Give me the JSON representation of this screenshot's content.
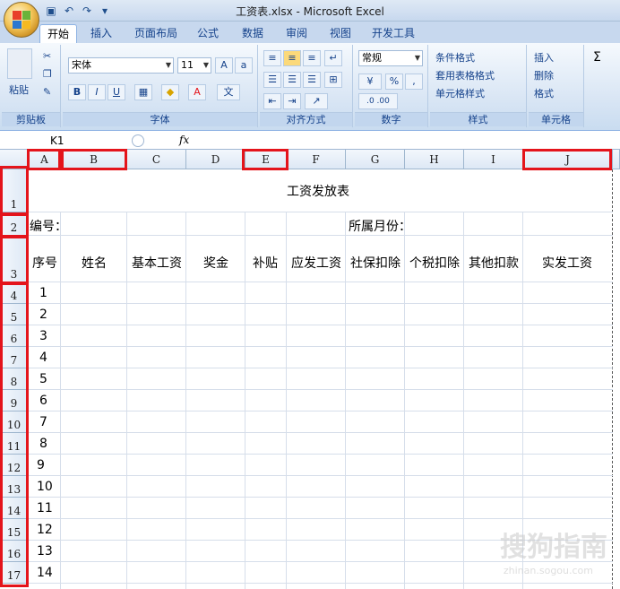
{
  "window": {
    "title": "工资表.xlsx - Microsoft Excel"
  },
  "qat": [
    "save-icon",
    "undo-icon",
    "redo-icon",
    "customize-icon"
  ],
  "tabs": [
    "开始",
    "插入",
    "页面布局",
    "公式",
    "数据",
    "审阅",
    "视图",
    "开发工具"
  ],
  "ribbon": {
    "clipboard": {
      "paste": "粘贴",
      "label": "剪贴板"
    },
    "font": {
      "name": "宋体",
      "size": "11",
      "bold": "B",
      "italic": "I",
      "underline": "U",
      "label": "字体"
    },
    "alignment": {
      "label": "对齐方式"
    },
    "number": {
      "format": "常规",
      "percent": "%",
      "comma": ",",
      "inc": ".0 .00",
      "label": "数字"
    },
    "styles": {
      "conditional": "条件格式",
      "table": "套用表格格式",
      "cell": "单元格样式",
      "label": "样式"
    },
    "cells": {
      "insert": "插入",
      "delete": "删除",
      "format": "格式",
      "label": "单元格"
    },
    "editing": {
      "sum": "Σ"
    }
  },
  "formula_bar": {
    "name_box": "K1",
    "fx": "fx",
    "value": ""
  },
  "columns": [
    "A",
    "B",
    "C",
    "D",
    "E",
    "F",
    "G",
    "H",
    "I",
    "J"
  ],
  "rows": [
    "1",
    "2",
    "3",
    "4",
    "5",
    "6",
    "7",
    "8",
    "9",
    "10",
    "11",
    "12",
    "13",
    "14",
    "15",
    "16",
    "17"
  ],
  "sheet": {
    "title": "工资发放表",
    "code_label": "编号：",
    "month_label": "所属月份：",
    "headers": [
      "序号",
      "姓名",
      "基本工资",
      "奖金",
      "补贴",
      "应发工资",
      "社保扣除",
      "个税扣除",
      "其他扣款",
      "实发工资"
    ],
    "serials": [
      "1",
      "2",
      "3",
      "4",
      "5",
      "6",
      "7",
      "8",
      "9",
      "10",
      "11",
      "12",
      "13",
      "14"
    ]
  },
  "watermark": {
    "text": "搜狗指南",
    "sub": "zhinan.sogou.com"
  },
  "colors": {
    "highlight": "#e4141b",
    "ribbon_text": "#15428b"
  }
}
